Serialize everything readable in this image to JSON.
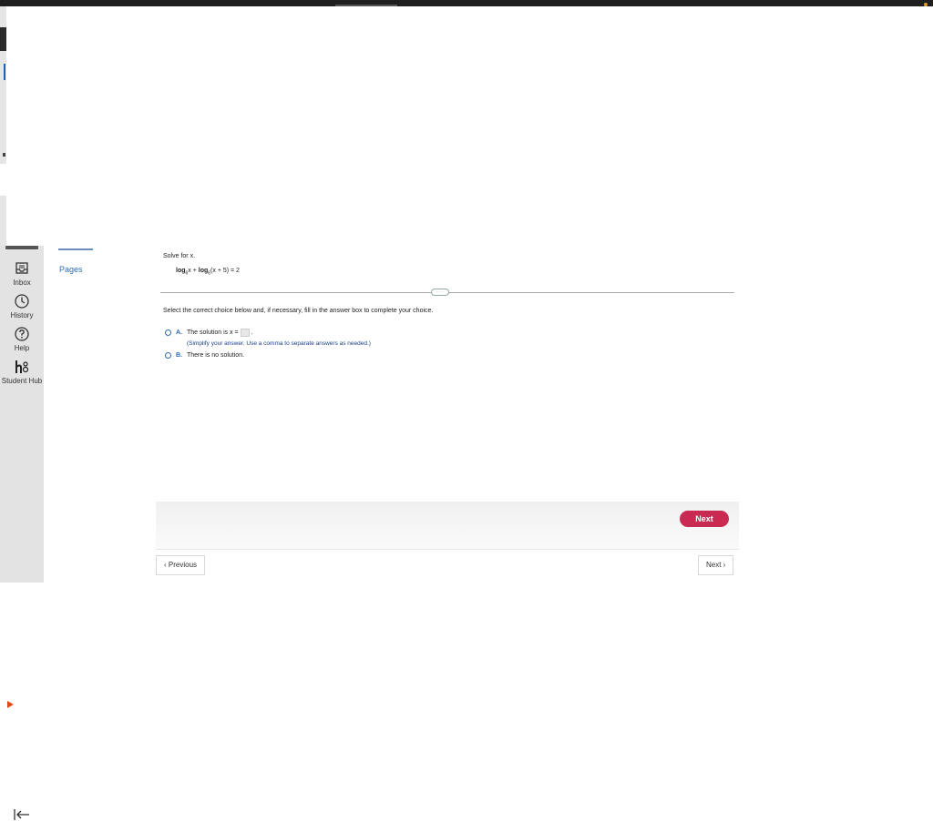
{
  "sidebar": {
    "items": [
      {
        "label": "Inbox",
        "icon": "inbox-icon"
      },
      {
        "label": "History",
        "icon": "clock-icon"
      },
      {
        "label": "Help",
        "icon": "help-icon"
      },
      {
        "label": "Student Hub",
        "icon": "student-hub-icon"
      }
    ]
  },
  "course_nav": {
    "pages_label": "Pages"
  },
  "question": {
    "prompt": "Solve for x.",
    "equation": {
      "log1": "log",
      "base1": "6",
      "arg1": "x",
      "plus": " + ",
      "log2": "log",
      "base2": "6",
      "arg2": "(x + 5) = 2"
    },
    "divider_label": "· · ·",
    "instruction": "Select the correct choice below and, if necessary, fill in the answer box to complete your choice.",
    "choices": [
      {
        "letter": "A.",
        "text_before": "The solution is x =",
        "text_after": "."
      },
      {
        "letter": "B.",
        "text": "There is no solution."
      }
    ],
    "hint": "(Simplify your answer. Use a comma to separate answers as needed.)"
  },
  "actions": {
    "next_primary": "Next",
    "previous": "‹ Previous",
    "next": "Next ›"
  },
  "colors": {
    "accent": "#c92a52",
    "link": "#2e6db4",
    "sidebar_bg": "#e3e3e3"
  }
}
